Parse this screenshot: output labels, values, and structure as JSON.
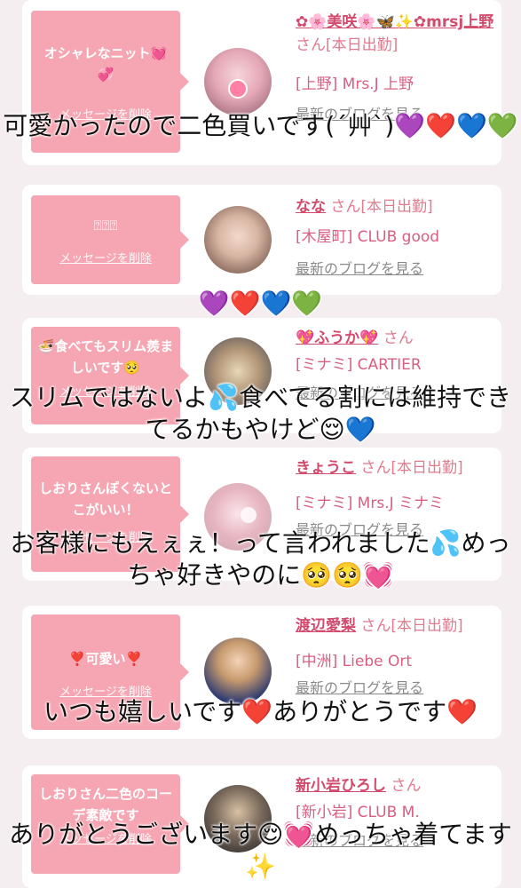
{
  "cards": [
    {
      "message": "オシャレなニット💓💞",
      "delete_label": "メッセージを削除",
      "name": "✿🌸美咲🌸🦋✨✿mrsj上野",
      "san": "さん[本日出勤]",
      "shop": "[上野] Mrs.J 上野",
      "blog": "最新のブログを見る"
    },
    {
      "message": "⍰⍰⍰",
      "delete_label": "メッセージを削除",
      "name": "なな",
      "san": "さん[本日出勤]",
      "shop": "[木屋町] CLUB good",
      "blog": "最新のブログを見る"
    },
    {
      "message": "🍜食べてもスリム羨ましいです🥺",
      "delete_label": "メッセージを削除",
      "name": "💖ふうか💖",
      "san": "さん",
      "shop": "[ミナミ] CARTIER",
      "blog": "最新のブログを見る"
    },
    {
      "message": "しおりさんぽくないとこがいい！",
      "delete_label": "メッセージを削除",
      "name": "きょうこ",
      "san": "さん[本日出勤]",
      "shop": "[ミナミ] Mrs.J ミナミ",
      "blog": "最新のブログを見る"
    },
    {
      "message": "❣️可愛い❣️",
      "delete_label": "メッセージを削除",
      "name": "渡辺愛梨",
      "san": "さん[本日出勤]",
      "shop": "[中洲] Liebe Ort",
      "blog": "最新のブログを見る"
    },
    {
      "message": "しおりさん二色のコーデ素敵です",
      "delete_label": "メッセージを削除",
      "name": "新小岩ひろし",
      "san": "さん",
      "shop": "[新小岩] CLUB M.",
      "blog": "最新のブログを見る"
    }
  ],
  "replies": [
    "可愛かったので二色買いです(´艸`)💜❤️💙💚",
    "💜❤️💙💚",
    "スリムではないよ💦食べてる割には維持できてるかもやけど😌💙",
    "お客様にもえぇぇ！って言われました💦めっちゃ好きやのに🥺🥺💓",
    "いつも嬉しいです❤️ありがとうです❤️",
    "ありがとうございます😌💓めっちゃ着てます✨"
  ],
  "colors": {
    "bubble": "#f6a5b2",
    "name": "#d24a6c",
    "accent": "#d85f80"
  }
}
